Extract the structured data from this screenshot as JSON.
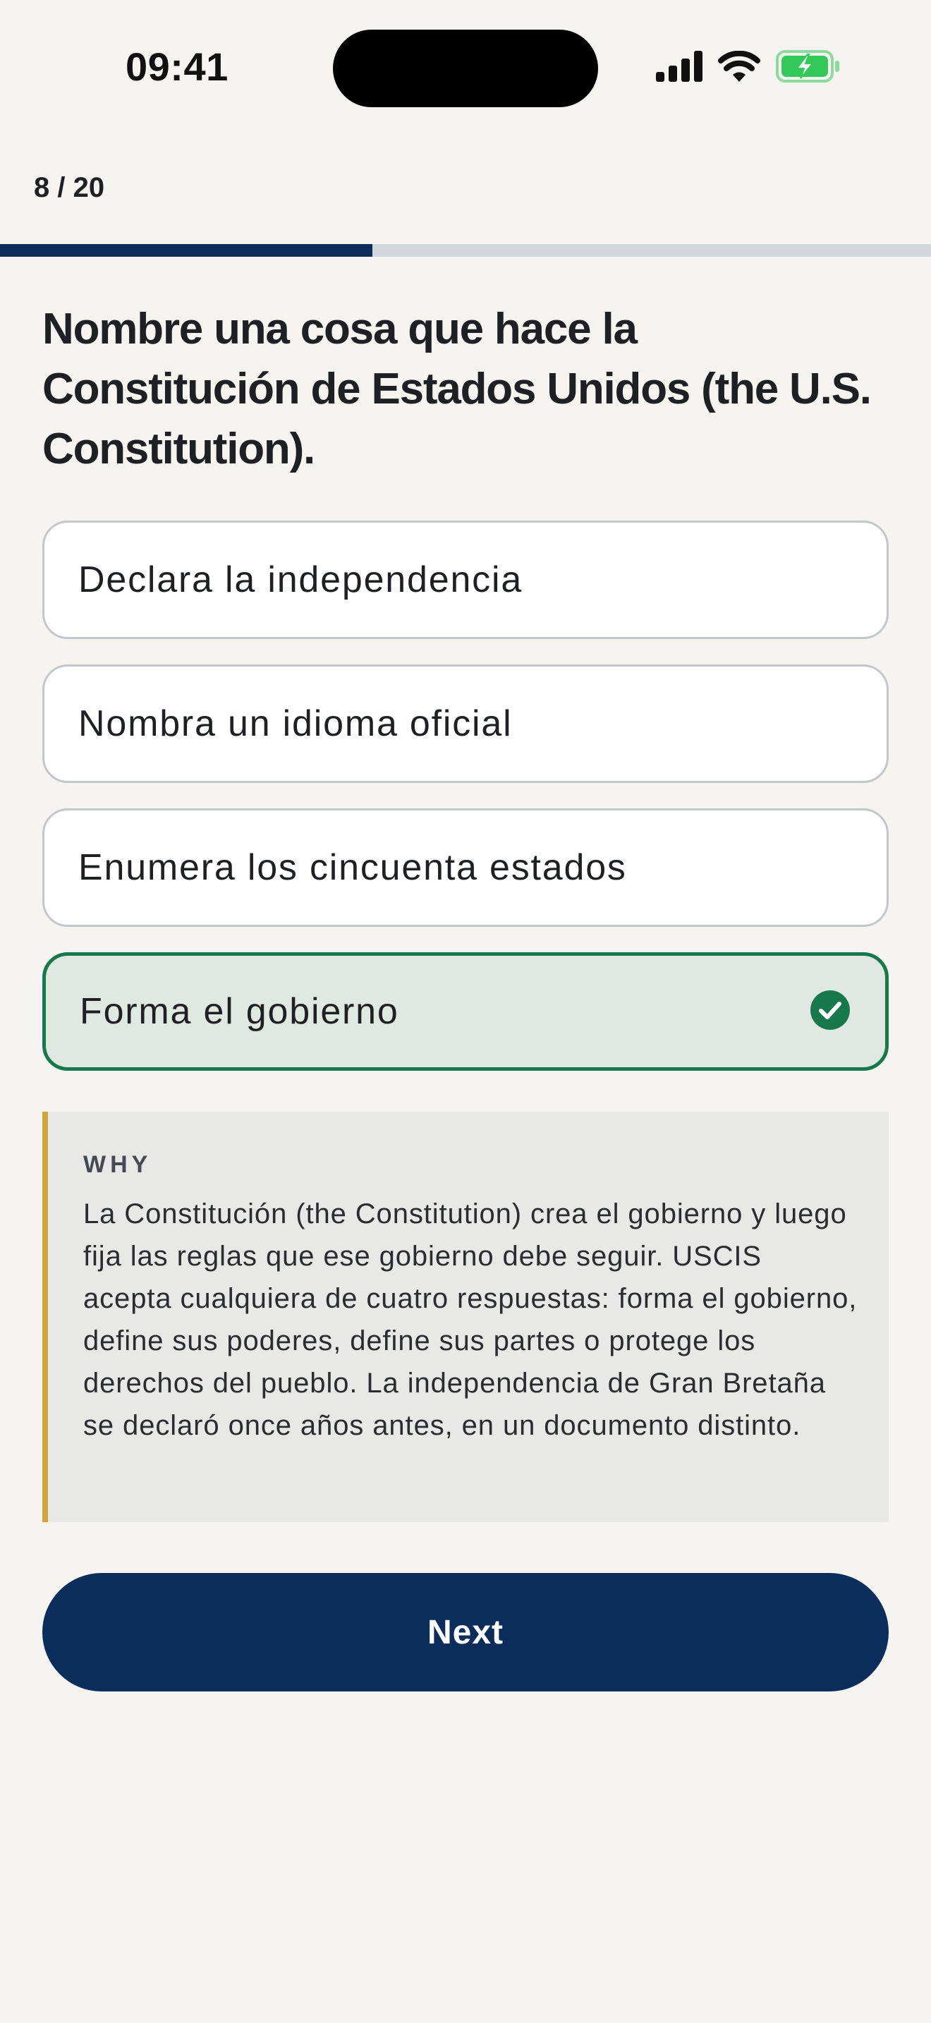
{
  "status_bar": {
    "time": "09:41"
  },
  "progress": {
    "label": "8 / 20",
    "current": 8,
    "total": 20
  },
  "question": {
    "text": "Nombre una cosa que hace la Constitución de Estados Unidos (the U.S. Constitution)."
  },
  "options": [
    {
      "label": "Declara la independencia",
      "state": "default"
    },
    {
      "label": "Nombra un idioma oficial",
      "state": "default"
    },
    {
      "label": "Enumera los cincuenta estados",
      "state": "default"
    },
    {
      "label": "Forma el gobierno",
      "state": "correct",
      "icon": "check-circle-icon"
    }
  ],
  "explanation": {
    "heading": "WHY",
    "text": "La Constitución (the Constitution) crea el gobierno y luego fija las reglas que ese gobierno debe seguir. USCIS acepta cualquiera de cuatro respuestas: forma el gobierno, define sus poderes, define sus partes o protege los derechos del pueblo. La independencia de Gran Bretaña se declaró once años antes, en un documento distinto."
  },
  "actions": {
    "next_label": "Next"
  },
  "colors": {
    "background": "#f5f4f0",
    "primary": "#0b2d5c",
    "correct": "#17784b",
    "correct_bg": "#e0e9e1",
    "accent_bar": "#d1a53a",
    "battery": "#34c759"
  },
  "icons": [
    "cellular-signal-icon",
    "wifi-icon",
    "battery-charging-icon",
    "check-circle-icon"
  ]
}
